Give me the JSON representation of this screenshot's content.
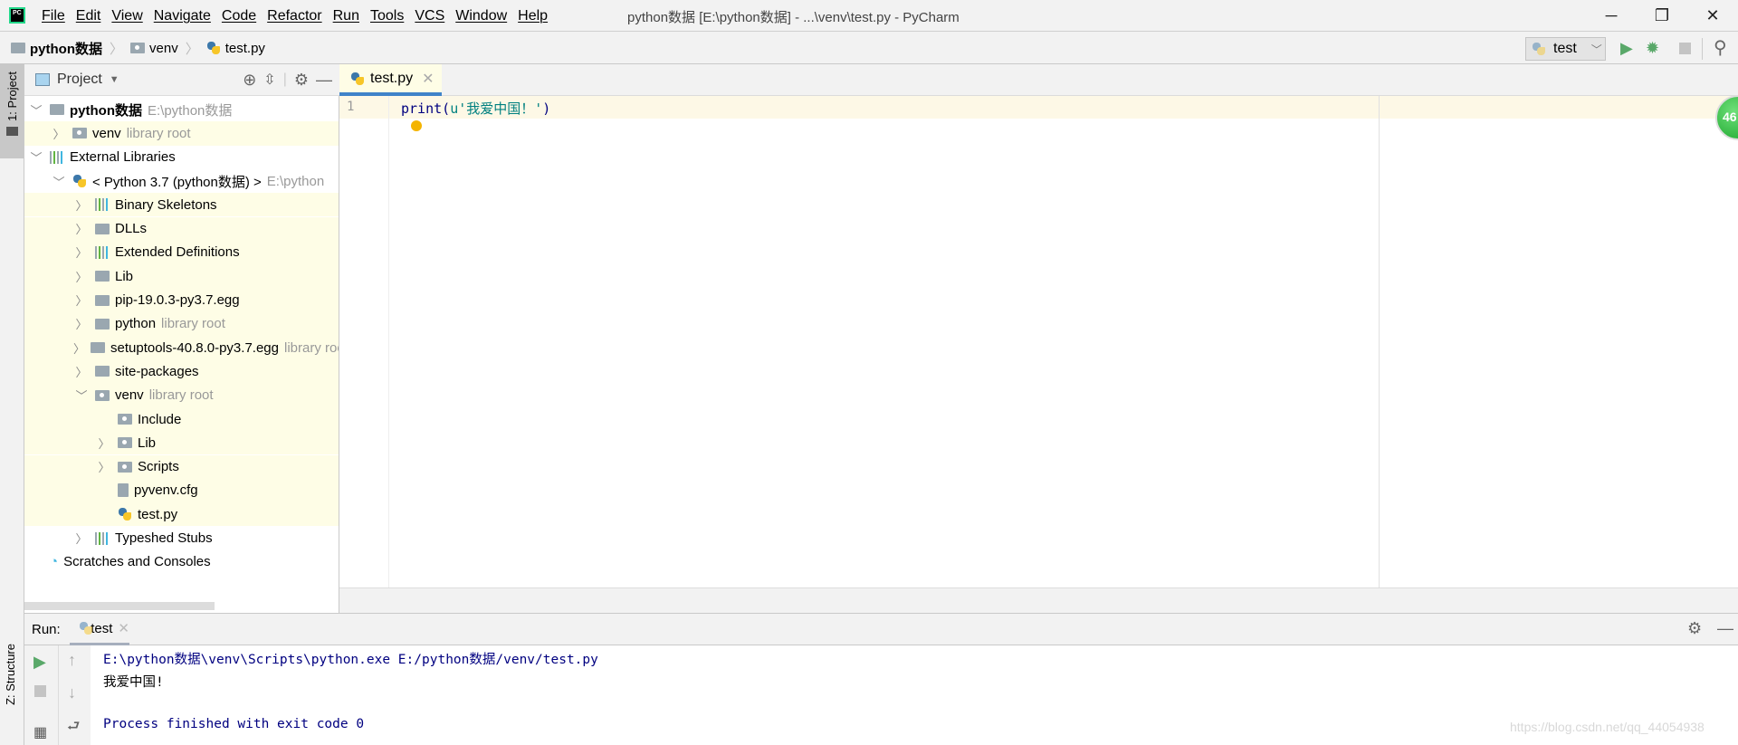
{
  "app": {
    "logo": "PC",
    "title": "python数据 [E:\\python数据] - ...\\venv\\test.py - PyCharm"
  },
  "menu": [
    "File",
    "Edit",
    "View",
    "Navigate",
    "Code",
    "Refactor",
    "Run",
    "Tools",
    "VCS",
    "Window",
    "Help"
  ],
  "breadcrumb": [
    "python数据",
    "venv",
    "test.py"
  ],
  "toolbar": {
    "run_config": "test"
  },
  "stripe": {
    "project_tab": "1: Project",
    "structure_tab": "Z: Structure"
  },
  "project": {
    "header": "Project",
    "tree": [
      {
        "label": "python数据",
        "hint": "E:\\python数据",
        "depth": 0,
        "expand": "open",
        "icon": "folder",
        "bold": true,
        "hl": false
      },
      {
        "label": "venv",
        "hint": "library root",
        "depth": 1,
        "expand": "closed",
        "icon": "lib-folder",
        "hl": true
      },
      {
        "label": "External Libraries",
        "hint": "",
        "depth": 0,
        "expand": "open",
        "icon": "library",
        "hl": false
      },
      {
        "label": "< Python 3.7 (python数据) >",
        "hint": "E:\\python",
        "depth": 1,
        "expand": "open",
        "icon": "python",
        "hl": false
      },
      {
        "label": "Binary Skeletons",
        "hint": "",
        "depth": 2,
        "expand": "closed",
        "icon": "library",
        "hl": true
      },
      {
        "label": "DLLs",
        "hint": "",
        "depth": 2,
        "expand": "closed",
        "icon": "folder",
        "hl": true
      },
      {
        "label": "Extended Definitions",
        "hint": "",
        "depth": 2,
        "expand": "closed",
        "icon": "library",
        "hl": true
      },
      {
        "label": "Lib",
        "hint": "",
        "depth": 2,
        "expand": "closed",
        "icon": "folder",
        "hl": true
      },
      {
        "label": "pip-19.0.3-py3.7.egg",
        "hint": "",
        "depth": 2,
        "expand": "closed",
        "icon": "folder",
        "hl": true
      },
      {
        "label": "python",
        "hint": "library root",
        "depth": 2,
        "expand": "closed",
        "icon": "folder",
        "hl": true
      },
      {
        "label": "setuptools-40.8.0-py3.7.egg",
        "hint": "library root",
        "depth": 2,
        "expand": "closed",
        "icon": "folder",
        "hl": true
      },
      {
        "label": "site-packages",
        "hint": "",
        "depth": 2,
        "expand": "closed",
        "icon": "folder",
        "hl": true
      },
      {
        "label": "venv",
        "hint": "library root",
        "depth": 2,
        "expand": "open",
        "icon": "lib-folder",
        "hl": true
      },
      {
        "label": "Include",
        "hint": "",
        "depth": 3,
        "expand": "none",
        "icon": "lib-folder",
        "hl": true
      },
      {
        "label": "Lib",
        "hint": "",
        "depth": 3,
        "expand": "closed",
        "icon": "lib-folder",
        "hl": true
      },
      {
        "label": "Scripts",
        "hint": "",
        "depth": 3,
        "expand": "closed",
        "icon": "lib-folder",
        "hl": true
      },
      {
        "label": "pyvenv.cfg",
        "hint": "",
        "depth": 3,
        "expand": "none",
        "icon": "file",
        "hl": true
      },
      {
        "label": "test.py",
        "hint": "",
        "depth": 3,
        "expand": "none",
        "icon": "python-file",
        "hl": true
      },
      {
        "label": "Typeshed Stubs",
        "hint": "",
        "depth": 2,
        "expand": "closed",
        "icon": "library",
        "hl": false
      },
      {
        "label": "Scratches and Consoles",
        "hint": "",
        "depth": 0,
        "expand": "none",
        "icon": "scratches",
        "hl": false
      }
    ]
  },
  "editor": {
    "tab": "test.py",
    "line_number": "1",
    "code_fn": "print(",
    "code_str": "u'我爱中国！'",
    "code_end": ")",
    "inspection_badge": "46"
  },
  "run": {
    "label": "Run:",
    "tab": "test",
    "console": [
      "E:\\python数据\\venv\\Scripts\\python.exe E:/python数据/venv/test.py",
      "我爱中国!",
      "",
      "Process finished with exit code 0"
    ]
  },
  "watermark": "https://blog.csdn.net/qq_44054938",
  "colors": {
    "accent": "#4083c9",
    "highlight": "#fefde6",
    "console_blue": "#000080",
    "run_green": "#59a869"
  }
}
